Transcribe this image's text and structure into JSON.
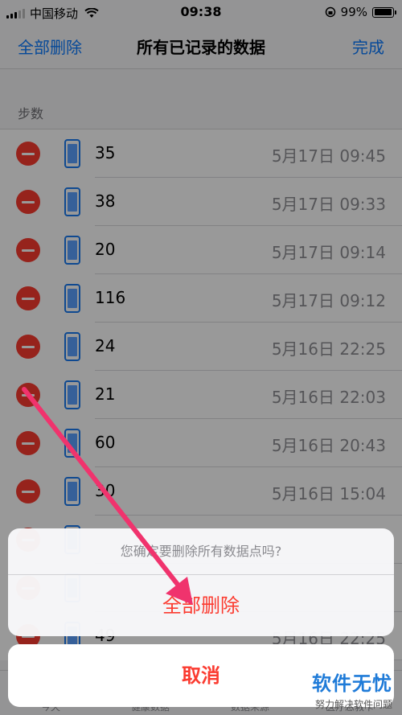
{
  "status_bar": {
    "carrier": "中国移动",
    "time": "09:38",
    "battery": "99%",
    "battery_level": 0.99
  },
  "nav": {
    "left_label": "全部删除",
    "title": "所有已记录的数据",
    "right_label": "完成"
  },
  "section": {
    "title": "步数"
  },
  "rows": [
    {
      "value": "35",
      "time": "5月17日 09:45"
    },
    {
      "value": "38",
      "time": "5月17日 09:33"
    },
    {
      "value": "20",
      "time": "5月17日 09:14"
    },
    {
      "value": "116",
      "time": "5月17日 09:12"
    },
    {
      "value": "24",
      "time": "5月16日 22:25"
    },
    {
      "value": "21",
      "time": "5月16日 22:03"
    },
    {
      "value": "60",
      "time": "5月16日 20:43"
    },
    {
      "value": "30",
      "time": "5月16日 15:04"
    },
    {
      "value": "",
      "time": ""
    },
    {
      "value": "",
      "time": ""
    },
    {
      "value": "49",
      "time": "5月16日 22:25"
    }
  ],
  "tab_bar": {
    "tabs": [
      "今天",
      "健康数据",
      "数据来源",
      "医疗急救卡"
    ]
  },
  "action_sheet": {
    "message": "您确定要删除所有数据点吗?",
    "destructive_label": "全部删除",
    "cancel_label": "取消"
  },
  "watermark": {
    "title": "软件无忧",
    "subtitle": "努力解决软件问题"
  },
  "colors": {
    "accent": "#0a7aff",
    "destructive": "#fb3b30",
    "arrow": "#f0336d",
    "watermark": "#1f7bd8"
  }
}
